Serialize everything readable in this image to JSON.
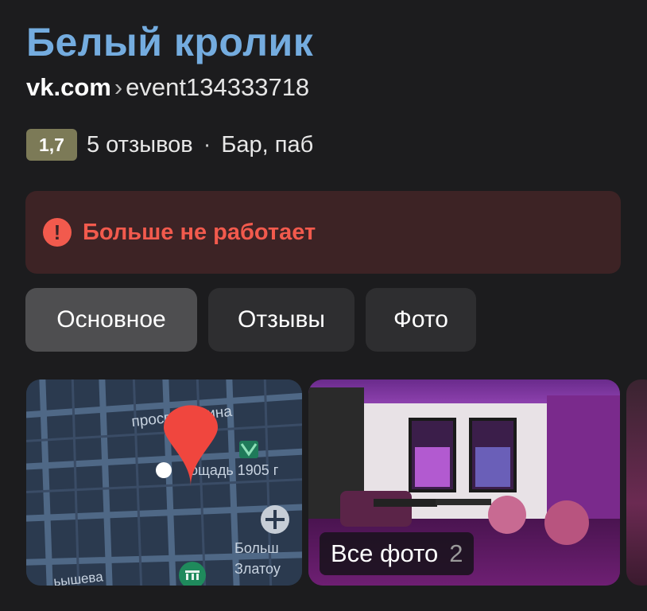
{
  "place": {
    "name": "Белый кролик",
    "url_domain": "vk.com",
    "url_separator": "›",
    "url_path": "event134333718",
    "rating": "1,7",
    "reviews": "5 отзывов",
    "meta_separator": "·",
    "category": "Бар, паб"
  },
  "status": {
    "icon": "exclamation-icon",
    "text": "Больше не работает",
    "color": "#f25a4d"
  },
  "tabs": [
    {
      "label": "Основное",
      "active": true
    },
    {
      "label": "Отзывы",
      "active": false
    },
    {
      "label": "Фото",
      "active": false
    }
  ],
  "map": {
    "labels": {
      "street_1": "просп. Ленина",
      "square": "ощадь 1905 г",
      "big_1": "Больш",
      "big_2": "Златоу",
      "street_2": "ьышева"
    },
    "marker_color": "#f0463e"
  },
  "gallery": {
    "all_photos_label": "Все фото",
    "count": "2"
  }
}
